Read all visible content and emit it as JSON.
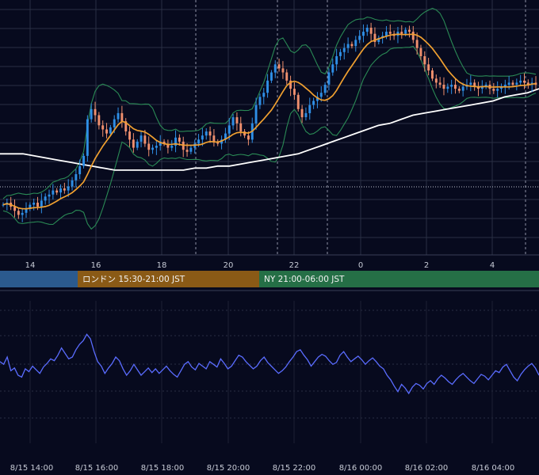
{
  "chart_data": [
    {
      "type": "candlestick",
      "name_in_ui": "",
      "x_ticks": [
        "14",
        "16",
        "18",
        "20",
        "22",
        "0",
        "2",
        "4"
      ],
      "sessions": [
        {
          "label": "",
          "color": "#2b5a8e"
        },
        {
          "label": "ロンドン 15:30-21:00 JST",
          "color": "#8a5a16"
        },
        {
          "label": "NY 21:00-06:00 JST",
          "color": "#256f46"
        }
      ],
      "colors": {
        "up_candle": "#2f8fe6",
        "down_candle": "#f0906e",
        "ma_short": "#f0a030",
        "ma_long": "#ffffff",
        "bands": "#2a8a55",
        "grid": "#2a2f44"
      },
      "series_close": [
        0.13,
        0.14,
        0.12,
        0.1,
        0.08,
        0.09,
        0.11,
        0.13,
        0.14,
        0.12,
        0.15,
        0.17,
        0.18,
        0.2,
        0.19,
        0.21,
        0.2,
        0.22,
        0.25,
        0.28,
        0.32,
        0.37,
        0.55,
        0.6,
        0.57,
        0.52,
        0.5,
        0.48,
        0.51,
        0.55,
        0.58,
        0.54,
        0.49,
        0.45,
        0.41,
        0.44,
        0.47,
        0.43,
        0.4,
        0.41,
        0.42,
        0.44,
        0.43,
        0.41,
        0.42,
        0.46,
        0.44,
        0.4,
        0.39,
        0.41,
        0.43,
        0.45,
        0.47,
        0.49,
        0.47,
        0.44,
        0.43,
        0.45,
        0.48,
        0.52,
        0.56,
        0.53,
        0.49,
        0.47,
        0.45,
        0.53,
        0.62,
        0.66,
        0.68,
        0.74,
        0.78,
        0.82,
        0.8,
        0.78,
        0.74,
        0.7,
        0.67,
        0.6,
        0.56,
        0.58,
        0.62,
        0.64,
        0.66,
        0.68,
        0.72,
        0.78,
        0.82,
        0.86,
        0.88,
        0.9,
        0.92,
        0.91,
        0.94,
        0.96,
        0.98,
        1.0,
        0.97,
        0.93,
        0.95,
        0.96,
        0.98,
        0.97,
        0.96,
        0.98,
        0.97,
        0.99,
        0.98,
        0.94,
        0.9,
        0.86,
        0.82,
        0.79,
        0.75,
        0.73,
        0.72,
        0.7,
        0.71,
        0.72,
        0.7,
        0.69,
        0.71,
        0.72,
        0.73,
        0.71,
        0.7,
        0.71,
        0.72,
        0.7,
        0.69,
        0.7,
        0.71,
        0.72,
        0.73,
        0.72,
        0.73,
        0.74,
        0.73,
        0.72,
        0.73,
        0.72
      ],
      "ma_long_values": [
        0.38,
        0.38,
        0.38,
        0.37,
        0.36,
        0.35,
        0.34,
        0.33,
        0.32,
        0.31,
        0.3,
        0.3,
        0.3,
        0.3,
        0.3,
        0.3,
        0.3,
        0.31,
        0.31,
        0.32,
        0.32,
        0.33,
        0.34,
        0.35,
        0.36,
        0.37,
        0.38,
        0.4,
        0.42,
        0.44,
        0.46,
        0.48,
        0.5,
        0.52,
        0.53,
        0.55,
        0.57,
        0.58,
        0.59,
        0.6,
        0.61,
        0.62,
        0.63,
        0.64,
        0.66,
        0.67,
        0.68,
        0.7
      ]
    },
    {
      "type": "line",
      "name_in_ui": "",
      "x_ticks": [
        "8/15 14:00",
        "8/15 16:00",
        "8/15 18:00",
        "8/15 20:00",
        "8/15 22:00",
        "8/16 00:00",
        "8/16 02:00",
        "8/16 04:00"
      ],
      "colors": {
        "line": "#5a6cff",
        "grid": "#2a2f44"
      },
      "values": [
        0.55,
        0.52,
        0.6,
        0.45,
        0.48,
        0.4,
        0.38,
        0.47,
        0.44,
        0.5,
        0.46,
        0.42,
        0.49,
        0.53,
        0.58,
        0.56,
        0.62,
        0.7,
        0.64,
        0.58,
        0.6,
        0.68,
        0.74,
        0.78,
        0.85,
        0.8,
        0.66,
        0.55,
        0.5,
        0.42,
        0.48,
        0.53,
        0.6,
        0.56,
        0.47,
        0.4,
        0.45,
        0.52,
        0.46,
        0.4,
        0.44,
        0.48,
        0.43,
        0.47,
        0.42,
        0.46,
        0.5,
        0.45,
        0.41,
        0.38,
        0.45,
        0.52,
        0.55,
        0.49,
        0.46,
        0.53,
        0.5,
        0.47,
        0.55,
        0.52,
        0.49,
        0.58,
        0.53,
        0.47,
        0.5,
        0.56,
        0.62,
        0.6,
        0.55,
        0.51,
        0.47,
        0.5,
        0.56,
        0.6,
        0.54,
        0.5,
        0.46,
        0.42,
        0.45,
        0.49,
        0.55,
        0.6,
        0.66,
        0.68,
        0.62,
        0.57,
        0.5,
        0.55,
        0.6,
        0.63,
        0.61,
        0.56,
        0.52,
        0.54,
        0.62,
        0.66,
        0.6,
        0.55,
        0.58,
        0.61,
        0.57,
        0.52,
        0.56,
        0.59,
        0.55,
        0.5,
        0.47,
        0.4,
        0.35,
        0.28,
        0.22,
        0.3,
        0.26,
        0.2,
        0.27,
        0.31,
        0.29,
        0.25,
        0.31,
        0.34,
        0.3,
        0.36,
        0.4,
        0.37,
        0.33,
        0.3,
        0.35,
        0.39,
        0.42,
        0.38,
        0.34,
        0.31,
        0.36,
        0.41,
        0.39,
        0.35,
        0.4,
        0.45,
        0.43,
        0.49,
        0.52,
        0.45,
        0.38,
        0.34,
        0.41,
        0.46,
        0.5,
        0.53,
        0.48,
        0.4
      ]
    }
  ]
}
